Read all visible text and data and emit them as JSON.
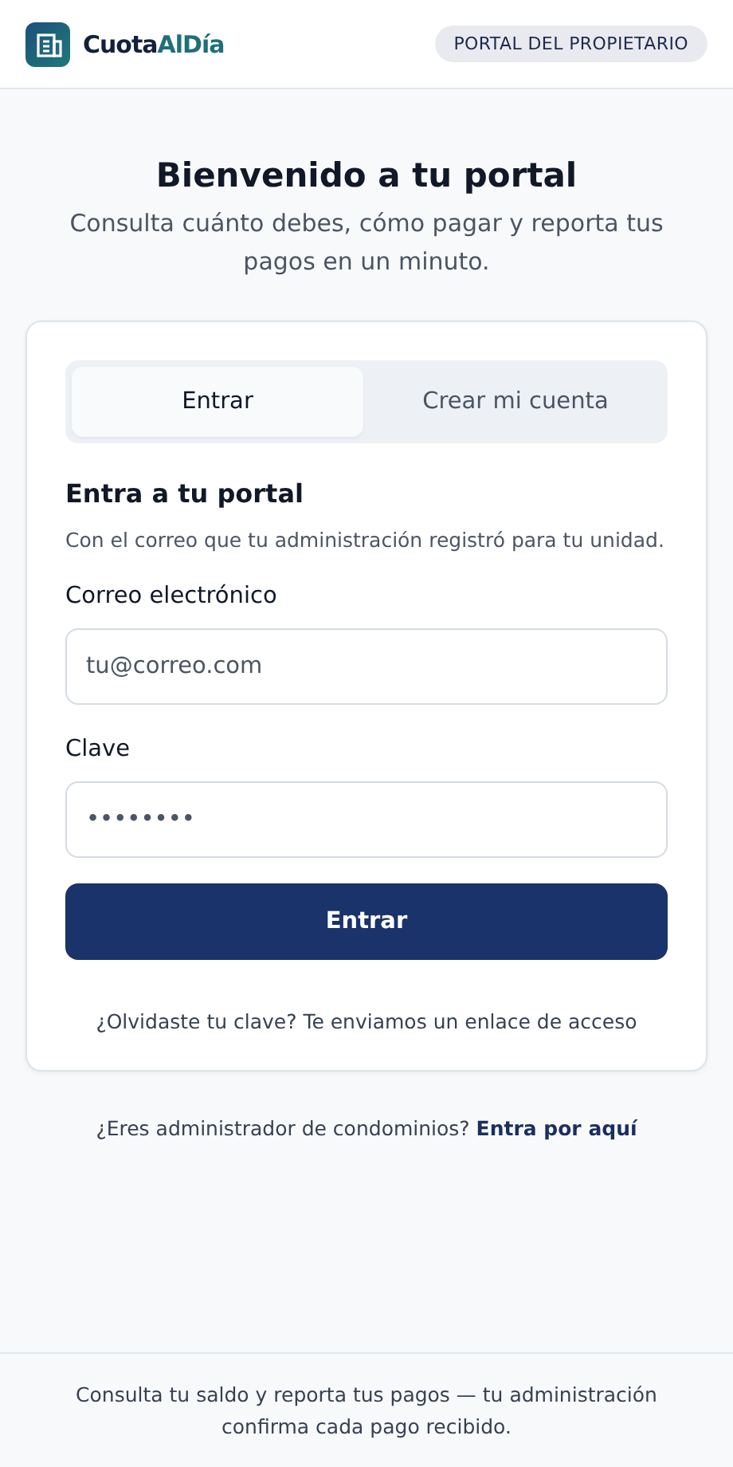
{
  "header": {
    "brand_primary": "Cuota",
    "brand_accent": "AlDía",
    "badge": "PORTAL DEL PROPIETARIO"
  },
  "hero": {
    "title": "Bienvenido a tu portal",
    "subtitle": "Consulta cuánto debes, cómo pagar y reporta tus pagos en un minuto."
  },
  "tabs": [
    {
      "label": "Entrar",
      "selected": true
    },
    {
      "label": "Crear mi cuenta",
      "selected": false
    }
  ],
  "form": {
    "heading": "Entra a tu portal",
    "description": "Con el correo que tu administración registró para tu unidad.",
    "fields": [
      {
        "label": "Correo electrónico",
        "placeholder": "tu@correo.com",
        "kind": "email"
      },
      {
        "label": "Clave",
        "placeholder": "••••••••",
        "kind": "password"
      }
    ],
    "submit": "Entrar",
    "forgot_link": "¿Olvidaste tu clave? Te enviamos un enlace de acceso"
  },
  "admin_prompt": {
    "text": "¿Eres administrador de condominios?",
    "link": "Entra por aquí"
  },
  "footer": "Consulta tu saldo y reporta tus pagos — tu administración confirma cada pago recibido."
}
